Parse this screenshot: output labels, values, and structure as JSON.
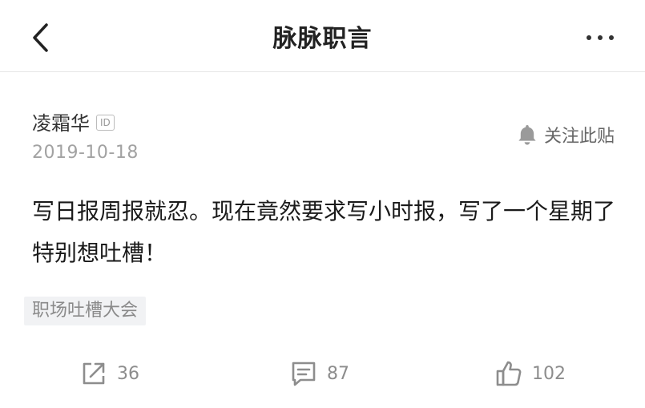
{
  "nav": {
    "title": "脉脉职言",
    "back_icon": "chevron-left-icon",
    "more_icon": "more-horizontal-icon"
  },
  "post": {
    "author": "凌霜华",
    "id_badge": "ID",
    "date": "2019-10-18",
    "follow_label": "关注此贴",
    "follow_icon": "bell-icon",
    "body": "写日报周报就忍。现在竟然要求写小时报，写了一个星期了特别想吐槽！",
    "tag": "职场吐槽大会"
  },
  "actions": {
    "share_count": "36",
    "comment_count": "87",
    "like_count": "102"
  },
  "colors": {
    "text_primary": "#1a1a1a",
    "text_secondary": "#a2a2a2",
    "icon_gray": "#8d8d8d",
    "tag_bg": "#f1f2f4",
    "divider": "#e6e6e6"
  }
}
